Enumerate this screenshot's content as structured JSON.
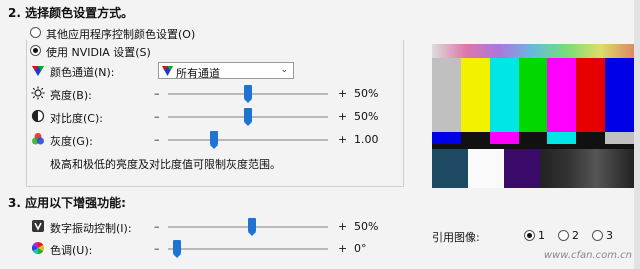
{
  "section2": {
    "heading": "2. 选择颜色设置方式。",
    "option_other": "其他应用程序控制颜色设置(O)",
    "option_nvidia": "使用 NVIDIA 设置(S)",
    "channel_label": "颜色通道(N):",
    "channel_value": "所有通道",
    "brightness_label": "亮度(B):",
    "brightness_value": "50%",
    "brightness_level": 0.5,
    "contrast_label": "对比度(C):",
    "contrast_value": "50%",
    "contrast_level": 0.5,
    "gamma_label": "灰度(G):",
    "gamma_value": "1.00",
    "note": "极高和极低的亮度及对比度值可限制灰度范围。",
    "minus": "–",
    "plus": "+"
  },
  "section3": {
    "heading": "3. 应用以下增强功能:",
    "vibrance_label": "数字振动控制(I):",
    "vibrance_value": "50%",
    "hue_label": "色调(U):",
    "hue_value": "0°",
    "reference_label": "引用图像:",
    "ref_options": [
      "1",
      "2",
      "3"
    ],
    "ref_selected": "1"
  },
  "icons": {
    "channel": "color-channel-icon",
    "brightness": "sun-icon",
    "contrast": "contrast-icon",
    "gamma": "rgb-circles-icon",
    "vibrance": "vibrance-icon",
    "hue": "hue-wheel-icon",
    "dropdown": "rgb-triangle-icon"
  },
  "colors": {
    "slider_thumb": "#1f74d2",
    "bars_top": [
      "#c0c0c0",
      "#f2f200",
      "#00e6e6",
      "#00d800",
      "#ff00ff",
      "#e60000",
      "#0000e6"
    ],
    "bars_mid": [
      "#0000e6",
      "#111111",
      "#ff00ff",
      "#111111",
      "#00e6e6",
      "#111111",
      "#c0c0c0"
    ]
  },
  "watermark": "www.cfan.com.cn"
}
